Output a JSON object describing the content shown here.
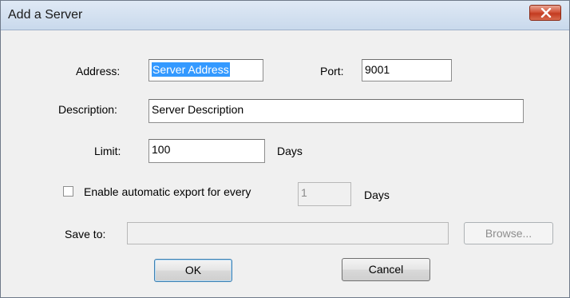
{
  "window": {
    "title": "Add a Server"
  },
  "form": {
    "address": {
      "label": "Address:",
      "value": "Server Address",
      "selected": true
    },
    "port": {
      "label": "Port:",
      "value": "9001"
    },
    "description": {
      "label": "Description:",
      "value": "Server Description"
    },
    "limit": {
      "label": "Limit:",
      "value": "100",
      "unit": "Days"
    },
    "auto_export": {
      "label": "Enable automatic export for every",
      "checked": false,
      "value": "1",
      "unit": "Days"
    },
    "save_to": {
      "label": "Save to:",
      "value": "",
      "browse_label": "Browse..."
    }
  },
  "buttons": {
    "ok_label": "OK",
    "cancel_label": "Cancel"
  },
  "colors": {
    "selection": "#3399ff",
    "close_button": "#c33b20",
    "dialog_bg": "#f0f0f0"
  },
  "icons": {
    "close": "close-icon"
  }
}
